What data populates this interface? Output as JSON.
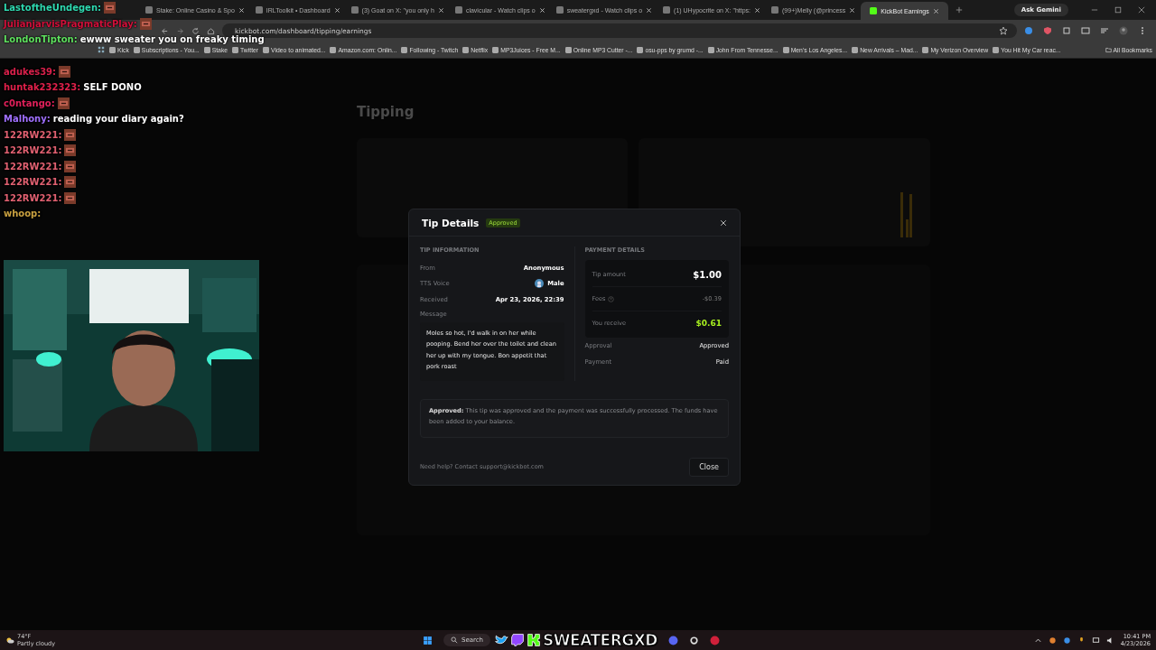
{
  "browser": {
    "tabs": [
      {
        "title": "Stake: Online Casino & Spo",
        "selected": false
      },
      {
        "title": "IRLToolkit • Dashboard",
        "selected": false
      },
      {
        "title": "(3) Goat on X: \"you only h",
        "selected": false
      },
      {
        "title": "clavicular - Watch clips o",
        "selected": false
      },
      {
        "title": "sweatergxd - Watch clips o",
        "selected": false
      },
      {
        "title": "(1) UHypocrite on X: \"https:",
        "selected": false
      },
      {
        "title": "(99+)Melly (@princess",
        "selected": false
      },
      {
        "title": "KickBot Earnings",
        "selected": true
      }
    ],
    "ask_gemini": "Ask Gemini",
    "address": "kickbot.com/dashboard/tipping/earnings",
    "bookmarks": [
      "Kick",
      "Subscriptions - You...",
      "Stake",
      "Twitter",
      "Video to animated...",
      "Amazon.com: Onlin...",
      "Following - Twitch",
      "Netflix",
      "MP3Juices - Free M...",
      "Online MP3 Cutter -...",
      "osu-pps by grumd -...",
      "John From Tennesse...",
      "Men's Los Angeles...",
      "New Arrivals – Mad...",
      "My Verizon Overview",
      "You Hit My Car reac..."
    ],
    "all_bookmarks": "All Bookmarks"
  },
  "page": {
    "heading": "Tipping"
  },
  "modal": {
    "title": "Tip Details",
    "status": "Approved",
    "tip_information": {
      "heading": "TIP INFORMATION",
      "fields": [
        {
          "label": "From",
          "value": "Anonymous",
          "kind": "text"
        },
        {
          "label": "TTS Voice",
          "value": "Male",
          "kind": "voice"
        },
        {
          "label": "Received",
          "value": "Apr 23, 2026, 22:39",
          "kind": "text"
        }
      ],
      "message_label": "Message",
      "message": "Moles so hot, I'd walk in on her while pooping. Bend her over the toilet and clean her up with my tongue. Bon appetit that pork roast"
    },
    "payment_details": {
      "heading": "PAYMENT DETAILS",
      "amounts": [
        {
          "label": "Tip amount",
          "value": "$1.00",
          "kind": "total"
        },
        {
          "label": "Fees",
          "value": "-$0.39",
          "kind": "fee"
        },
        {
          "label": "You receive",
          "value": "$0.61",
          "kind": "net"
        }
      ],
      "fields": [
        {
          "label": "Approval",
          "value": "Approved"
        },
        {
          "label": "Payment",
          "value": "Paid"
        }
      ]
    },
    "note": "**Approved:** This tip was approved and the payment was successfully processed. The funds have been added to your balance.",
    "help": "Need help? Contact support@kickbot.com",
    "close": "Close"
  },
  "chat": [
    {
      "user": "LastoftheUndegen:",
      "color": "#2fd9b0",
      "emote": true
    },
    {
      "user": "JulianjarvisPragmaticPlay:",
      "color": "#d0103a",
      "emote": true
    },
    {
      "user": "LondonTipton:",
      "color": "#5fe05f",
      "message": "ewww sweater you on freaky timing",
      "emote": false
    },
    {
      "user": "adukes39:",
      "color": "#d8204a",
      "emote": true
    },
    {
      "user": "huntak232323:",
      "color": "#e0204a",
      "message": "SELF DONO",
      "emote": false
    },
    {
      "user": "c0ntango:",
      "color": "#e0205a",
      "emote": true
    },
    {
      "user": "Malhony:",
      "color": "#a070ff",
      "message": "reading your diary again?",
      "emote": false
    },
    {
      "user": "122RW221:",
      "color": "#e06070",
      "emote": true
    },
    {
      "user": "122RW221:",
      "color": "#e06070",
      "emote": true
    },
    {
      "user": "122RW221:",
      "color": "#e06070",
      "emote": true
    },
    {
      "user": "122RW221:",
      "color": "#e06070",
      "emote": true
    },
    {
      "user": "122RW221:",
      "color": "#e06070",
      "emote": true
    },
    {
      "user": "whoop:",
      "color": "#c8a040",
      "emote": false
    }
  ],
  "taskbar": {
    "weather": {
      "temp": "74°F",
      "condition": "Partly cloudy"
    },
    "search": "Search",
    "overlay_name": "SWEATERGXD",
    "time": "10:41 PM",
    "date": "4/23/2026"
  }
}
